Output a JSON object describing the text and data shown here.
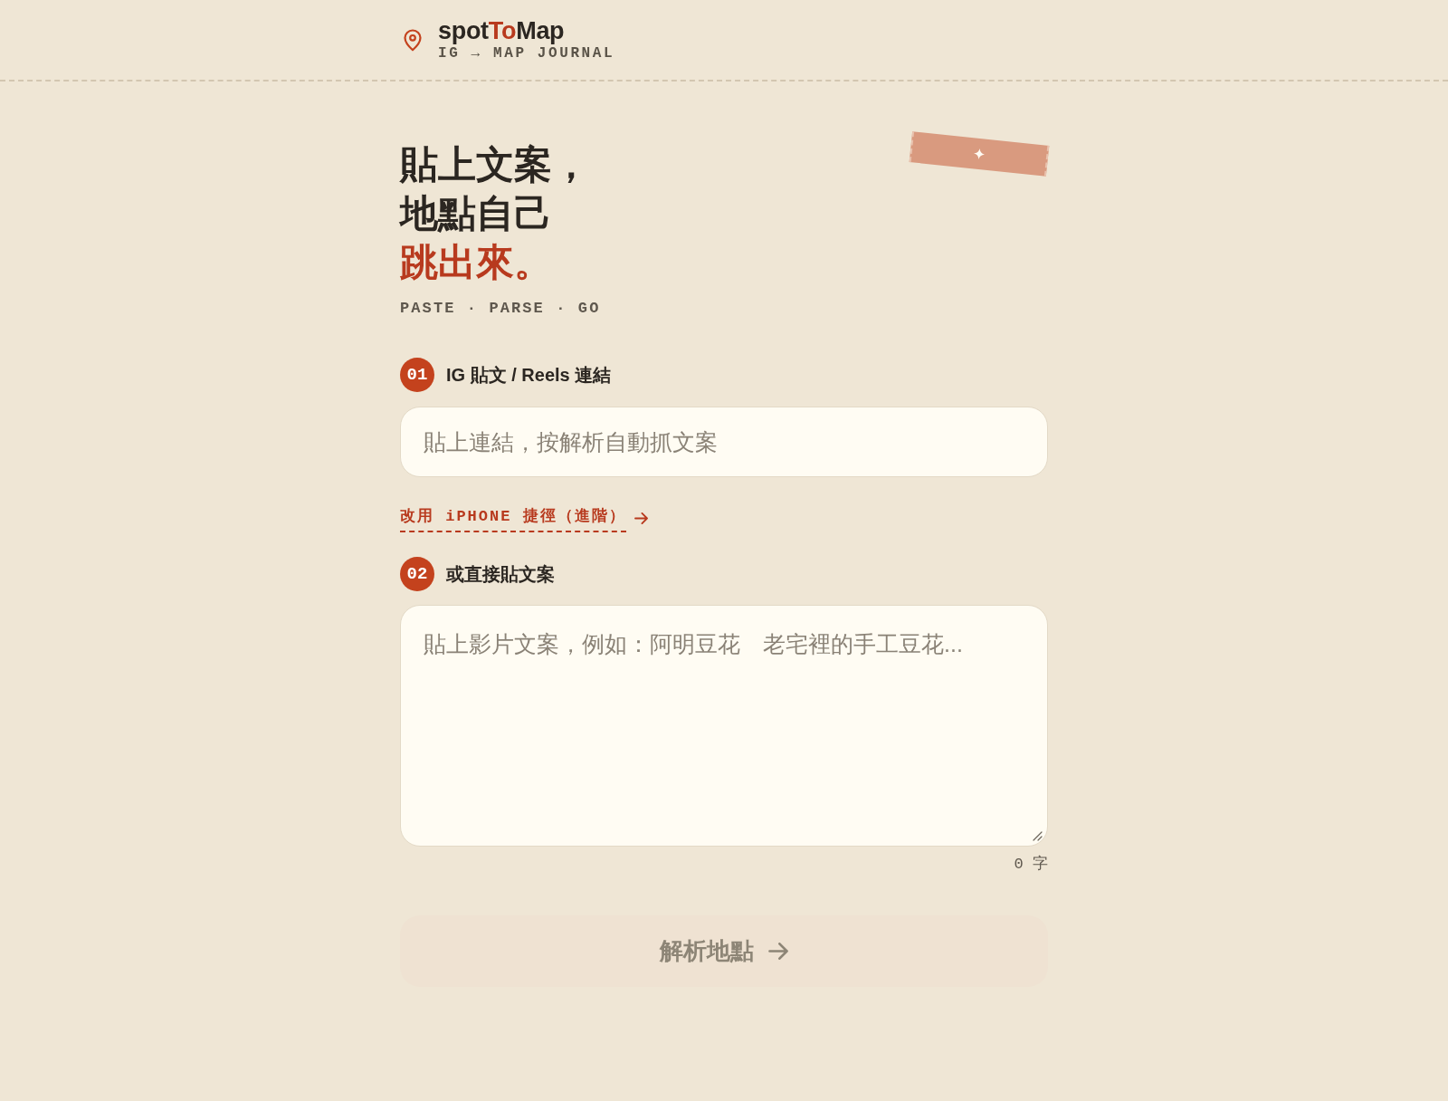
{
  "header": {
    "brand": [
      {
        "text": "spot",
        "accent": false
      },
      {
        "text": "To",
        "accent": true
      },
      {
        "text": "Map",
        "accent": false
      }
    ],
    "tagline": "IG → MAP JOURNAL"
  },
  "hero": {
    "headline": [
      {
        "text": "貼上文案，",
        "accent": false
      },
      {
        "text": "地點自己",
        "accent": false
      },
      {
        "text": "跳出來。",
        "accent": true
      }
    ],
    "subtitle": "PASTE · PARSE · GO"
  },
  "steps": [
    {
      "number": "01",
      "label": "IG 貼文 / Reels 連結",
      "kind": "input",
      "placeholder": "貼上連結，按解析自動抓文案",
      "shortcut_link": "改用 iPHONE 捷徑（進階）"
    },
    {
      "number": "02",
      "label": "或直接貼文案",
      "kind": "textarea",
      "placeholder": "貼上影片文案，例如：阿明豆花　老宅裡的手工豆花...",
      "counter": "0 字"
    }
  ],
  "submit": {
    "label": "解析地點",
    "disabled": true
  }
}
